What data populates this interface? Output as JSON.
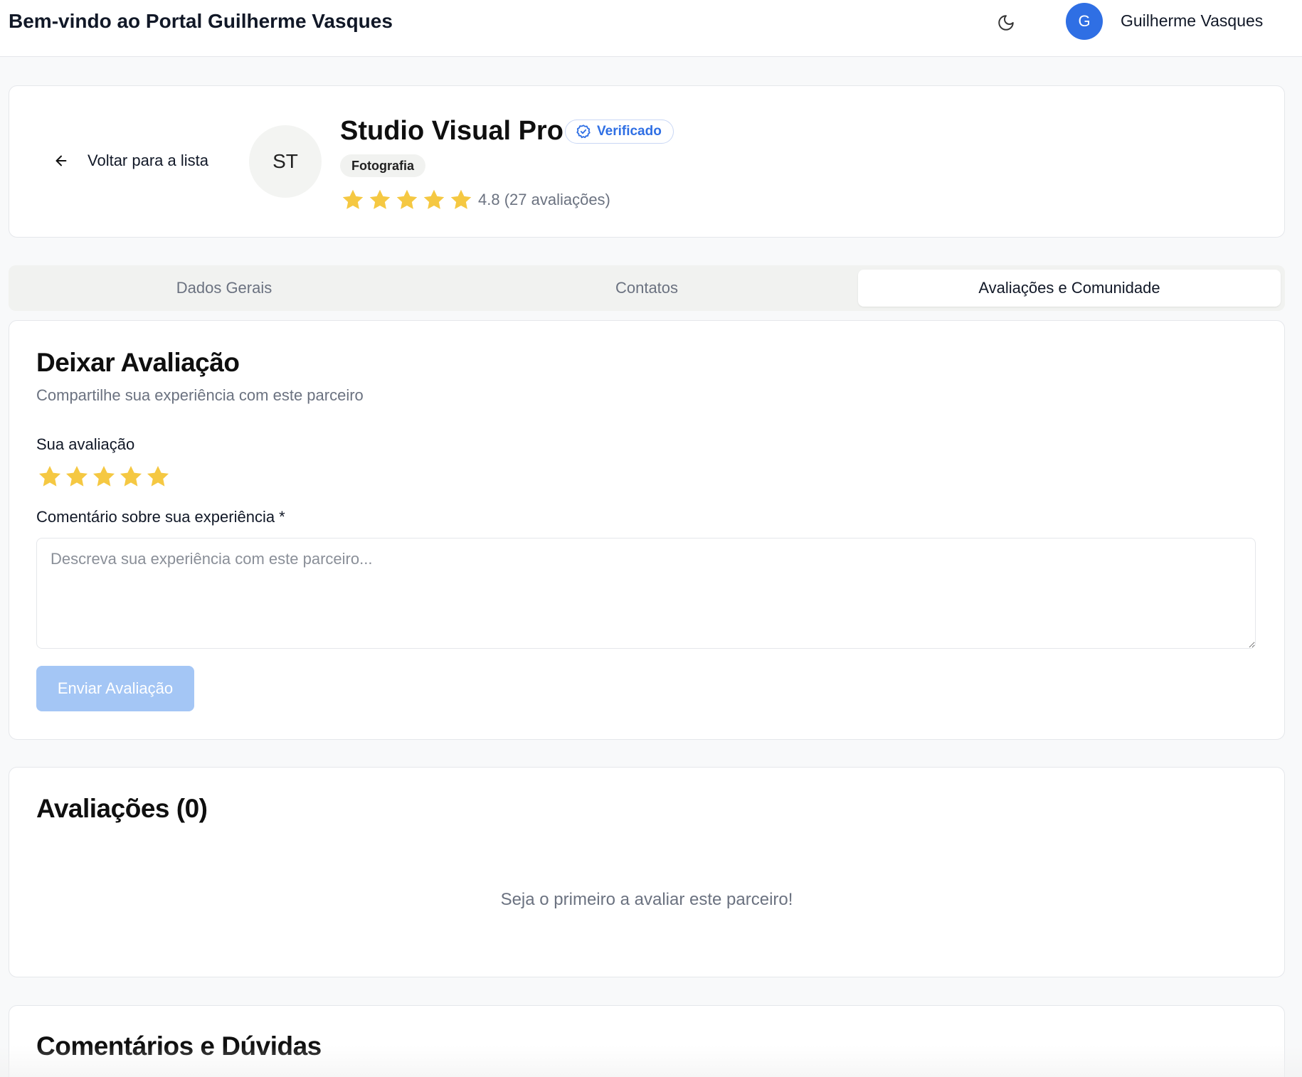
{
  "topbar": {
    "title": "Bem-vindo ao Portal Guilherme Vasques",
    "theme_icon": "moon-icon",
    "avatar_initial": "G",
    "user_name": "Guilherme Vasques"
  },
  "partner": {
    "back_label": "Voltar para a lista",
    "back_icon": "arrow-left-icon",
    "initials": "ST",
    "name": "Studio Visual Pro",
    "verified_label": "Verificado",
    "verified_icon": "badge-check-icon",
    "category": "Fotografia",
    "rating": 4.8,
    "stars_filled": 5,
    "rating_text": "4.8 (27 avaliações)"
  },
  "tabs": [
    {
      "label": "Dados Gerais",
      "active": false
    },
    {
      "label": "Contatos",
      "active": false
    },
    {
      "label": "Avaliações e Comunidade",
      "active": true
    }
  ],
  "review_form": {
    "title": "Deixar Avaliação",
    "subtitle": "Compartilhe sua experiência com este parceiro",
    "rating_label": "Sua avaliação",
    "selected_stars": 5,
    "comment_label": "Comentário sobre sua experiência *",
    "comment_value": "",
    "comment_placeholder": "Descreva sua experiência com este parceiro...",
    "submit_label": "Enviar Avaliação"
  },
  "reviews": {
    "title": "Avaliações (0)",
    "empty_message": "Seja o primeiro a avaliar este parceiro!"
  },
  "comments": {
    "title": "Comentários e Dúvidas"
  },
  "colors": {
    "accent": "#2f6fe4",
    "star": "#f5c842",
    "submit_disabled": "#a4c6f5",
    "muted_text": "#6b7280"
  }
}
